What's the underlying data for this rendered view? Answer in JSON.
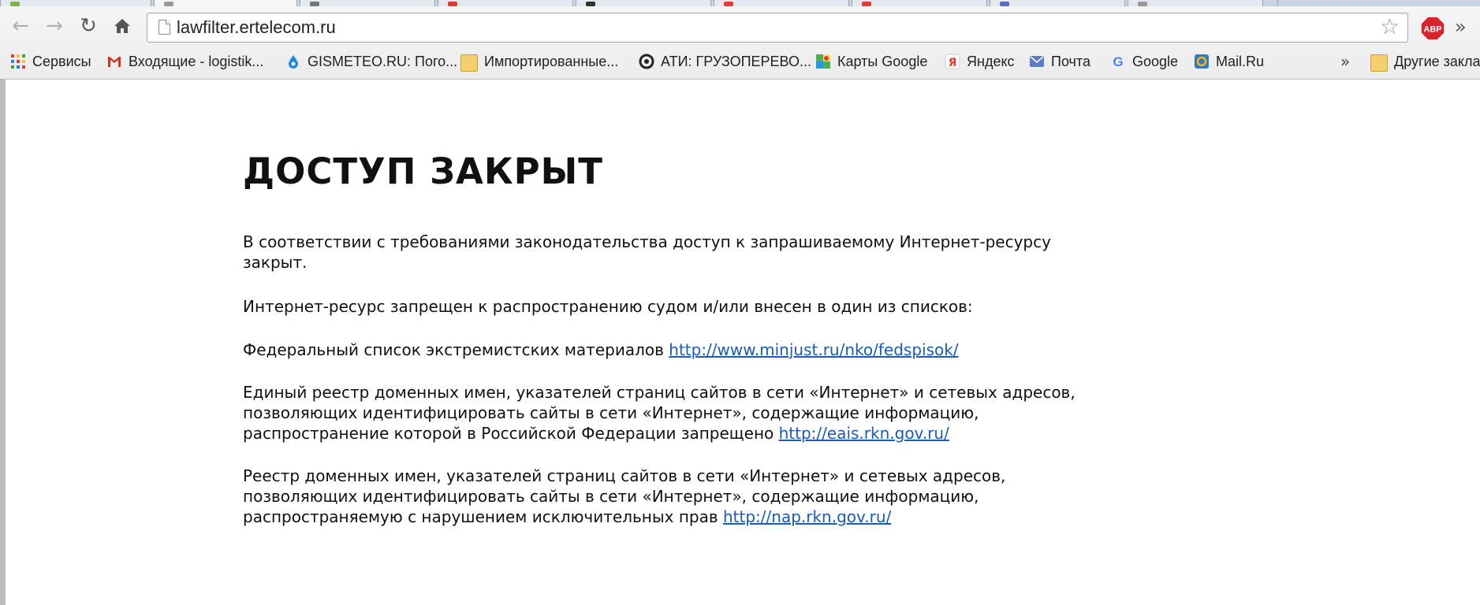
{
  "browser": {
    "url": "lawfilter.ertelecom.ru",
    "adblock_label": "ABP",
    "back_icon": "back-arrow-icon",
    "forward_icon": "forward-arrow-icon",
    "reload_icon": "reload-icon",
    "home_icon": "home-icon",
    "star_icon": "star-icon",
    "more_label": "»"
  },
  "bookmarks": {
    "items": [
      {
        "label": "Сервисы",
        "icon": "apps-grid-icon"
      },
      {
        "label": "Входящие - logistik...",
        "icon": "gmail-icon"
      },
      {
        "label": "GISMETEO.RU: Пого...",
        "icon": "gismeteo-icon"
      },
      {
        "label": "Импортированные...",
        "icon": "folder-icon"
      },
      {
        "label": "АТИ: ГРУЗОПЕРЕВО...",
        "icon": "ati-icon"
      },
      {
        "label": "Карты Google",
        "icon": "maps-icon"
      },
      {
        "label": "Яндекс",
        "icon": "yandex-icon"
      },
      {
        "label": "Почта",
        "icon": "mail-icon"
      },
      {
        "label": "Google",
        "icon": "google-icon"
      },
      {
        "label": "Mail.Ru",
        "icon": "mailru-icon"
      }
    ],
    "chevron": "»",
    "other_label": "Другие закладки"
  },
  "page": {
    "title": "ДОСТУП ЗАКРЫТ",
    "p1": "В соответствии с требованиями законодательства доступ к запрашиваемому Интернет-ресурсу закрыт.",
    "p2": "Интернет-ресурс запрещен к распространению судом и/или внесен в один из списков:",
    "p3_text": "Федеральный список экстремистских материалов",
    "p3_link": "http://www.minjust.ru/nko/fedspisok/",
    "p4_text": "Единый реестр доменных имен, указателей страниц сайтов в сети «Интернет» и сетевых адресов, позволяющих идентифицировать сайты в сети «Интернет», содержащие информацию, распространение которой в Российской Федерации запрещено",
    "p4_link": "http://eais.rkn.gov.ru/",
    "p5_text": "Реестр доменных имен, указателей страниц сайтов в сети «Интернет» и сетевых адресов, позволяющих идентифицировать сайты в сети «Интернет», содержащие информацию, распространяемую с нарушением исключительных прав",
    "p5_link": "http://nap.rkn.gov.ru/"
  },
  "colors": {
    "link": "#1a5bb8",
    "abp_red": "#d8232a"
  }
}
